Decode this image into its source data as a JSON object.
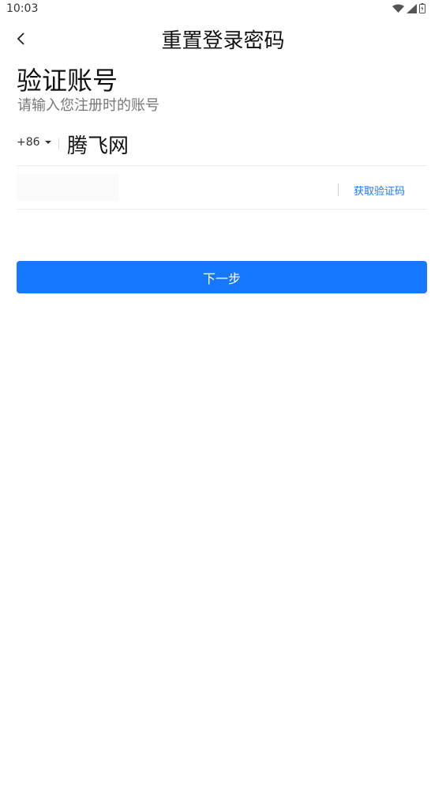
{
  "status_bar": {
    "time": "10:03",
    "icons": [
      "wifi-icon",
      "signal-icon",
      "battery-icon"
    ]
  },
  "header": {
    "title": "重置登录密码",
    "back_icon": "chevron-left-icon"
  },
  "main": {
    "heading": "验证账号",
    "subheading": "请输入您注册时的账号",
    "country_code": "+86",
    "phone_value": "腾飞网",
    "code_placeholder": "",
    "get_code_label": "获取验证码",
    "next_label": "下一步"
  },
  "colors": {
    "accent": "#1677ff",
    "divider": "#ececec",
    "muted_text": "#777777"
  }
}
